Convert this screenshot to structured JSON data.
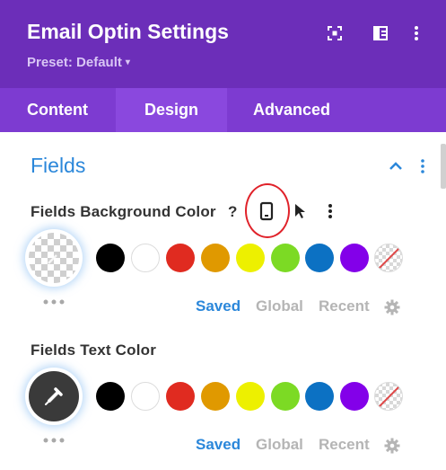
{
  "header": {
    "title": "Email Optin Settings",
    "preset_label": "Preset: Default",
    "preset_caret": "▾",
    "icons": [
      "fullscreen-icon",
      "sidebar-layout-icon",
      "kebab-menu-icon"
    ]
  },
  "tabs": [
    {
      "label": "Content",
      "active": false
    },
    {
      "label": "Design",
      "active": true
    },
    {
      "label": "Advanced",
      "active": false
    }
  ],
  "section": {
    "title": "Fields",
    "icons": [
      "chevron-up-icon",
      "kebab-menu-icon"
    ]
  },
  "fields_bg": {
    "label": "Fields Background Color",
    "help": "?",
    "icons": [
      "help-icon",
      "mobile-device-icon",
      "cursor-hover-icon",
      "kebab-menu-icon"
    ],
    "preview_state": "transparent"
  },
  "fields_text": {
    "label": "Fields Text Color",
    "preview_state": "eyedropper"
  },
  "swatches": [
    {
      "name": "black",
      "color": "#000000"
    },
    {
      "name": "white",
      "color": "#ffffff"
    },
    {
      "name": "red",
      "color": "#e02b20"
    },
    {
      "name": "orange",
      "color": "#e09900"
    },
    {
      "name": "yellow",
      "color": "#edf000"
    },
    {
      "name": "green",
      "color": "#7cda24"
    },
    {
      "name": "blue",
      "color": "#0c71c3"
    },
    {
      "name": "purple",
      "color": "#8300e9"
    },
    {
      "name": "none",
      "color": "transparent"
    }
  ],
  "palette_tabs": {
    "saved": "Saved",
    "global": "Global",
    "recent": "Recent"
  },
  "colors": {
    "header_bg": "#6c2eb9",
    "tabs_bg": "#7d3bd1",
    "active_tab_bg": "#8a48de",
    "accent_blue": "#2b87da",
    "highlight_ring": "#e0222a"
  }
}
